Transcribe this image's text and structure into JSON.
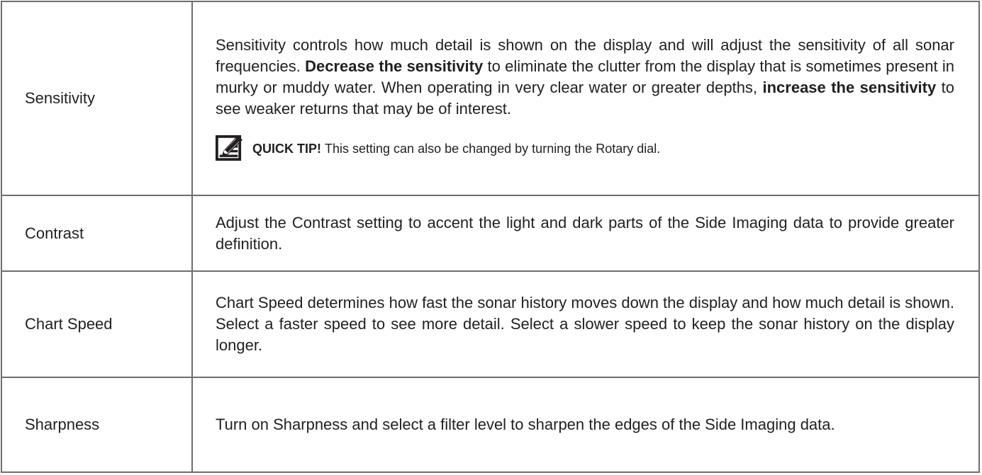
{
  "rows": [
    {
      "label": "Sensitivity",
      "desc_part1": "Sensitivity controls how much detail is shown on the display and will adjust the sensitivity of all sonar frequencies. ",
      "desc_bold1": "Decrease the sensitivity",
      "desc_part2": " to eliminate the clutter from the display that is sometimes present in murky or muddy water. When operating in very clear water or greater depths, ",
      "desc_bold2": "increase the sensitivity",
      "desc_part3": " to see weaker returns that may be of interest.",
      "tip_label": "QUICK TIP!",
      "tip_text": "This setting can also be changed by turning the Rotary dial.",
      "tip_icon": "checklist-pencil-icon"
    },
    {
      "label": "Contrast",
      "description": "Adjust the Contrast setting to accent the light and dark parts of the Side Imaging data to provide greater definition."
    },
    {
      "label": "Chart Speed",
      "description": "Chart Speed determines how fast the sonar history moves down the display and how much detail is shown. Select a faster speed to see more detail. Select a slower speed to keep the sonar history on the display longer."
    },
    {
      "label": "Sharpness",
      "description": "Turn on Sharpness and select a filter level to sharpen the edges of the Side Imaging data."
    }
  ],
  "colors": {
    "border": "#6d6e71",
    "text": "#231f20"
  }
}
